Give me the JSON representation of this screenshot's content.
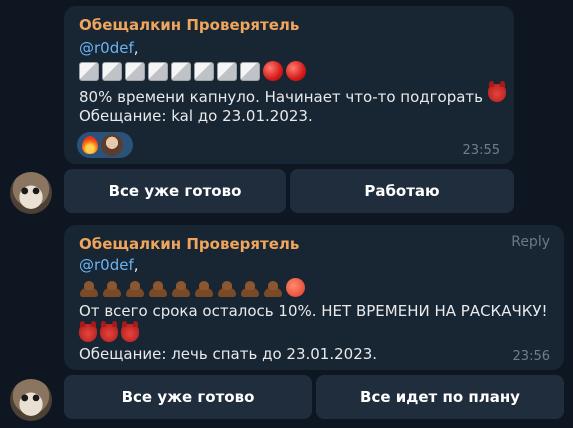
{
  "messages": [
    {
      "sender": "Обещалкин Проверятель",
      "mention": "@r0def",
      "mention_suffix": ",",
      "progress_emojis": "white cubes x8, red circles x2",
      "text": "80% времени капнуло. Начинает что-то подгорать",
      "promise": "Обещание:  kal до 23.01.2023.",
      "time": "23:55",
      "reactions": [
        "fire",
        "user-avatar"
      ],
      "buttons": [
        "Все уже готово",
        "Работаю"
      ]
    },
    {
      "sender": "Обещалкин Проверятель",
      "reply_label": "Reply",
      "mention": "@r0def",
      "mention_suffix": ",",
      "progress_emojis": "poo x9, hot face x1",
      "text": "От всего срока осталось 10%. НЕТ ВРЕМЕНИ НА РАСКАЧКУ!",
      "promise": "Обещание:  лечь спать до 23.01.2023.",
      "time": "23:56",
      "buttons": [
        "Все уже готово",
        "Все идет по плану"
      ]
    }
  ]
}
